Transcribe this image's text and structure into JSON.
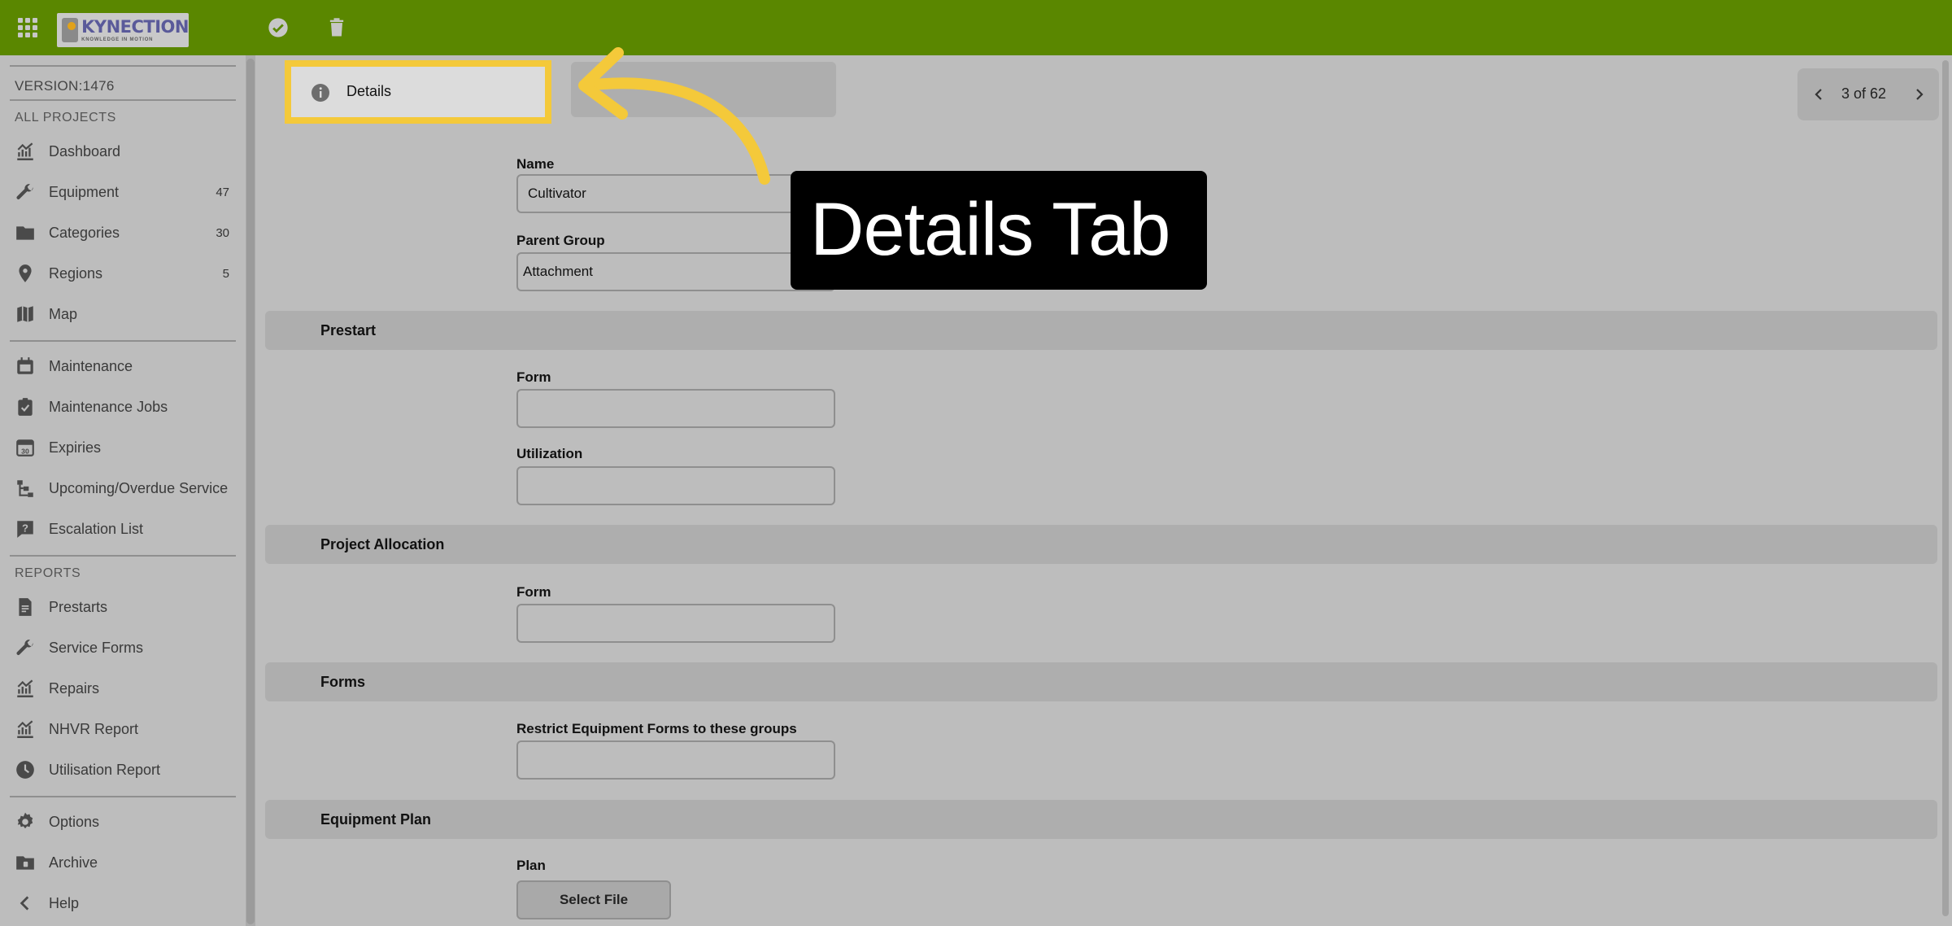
{
  "colors": {
    "topbar": "#5a8700",
    "highlight": "#f4c93a",
    "background": "#bdbdbd",
    "section": "#aeaeae",
    "callout_bg": "#000000",
    "callout_text": "#ffffff"
  },
  "topbar": {
    "logo_title": "KYNECTION",
    "logo_subtitle": "KNOWLEDGE IN MOTION",
    "icons": [
      "apps-grid-icon",
      "check-circle-icon",
      "trash-icon"
    ]
  },
  "sidebar": {
    "version": "VERSION:1476",
    "projects_heading": "ALL PROJECTS",
    "project_items": [
      {
        "label": "Dashboard",
        "count": "",
        "icon": "chart-icon"
      },
      {
        "label": "Equipment",
        "count": "47",
        "icon": "wrench-icon"
      },
      {
        "label": "Categories",
        "count": "30",
        "icon": "folder-icon"
      },
      {
        "label": "Regions",
        "count": "5",
        "icon": "map-pin-icon"
      },
      {
        "label": "Map",
        "count": "",
        "icon": "map-icon"
      }
    ],
    "maintenance_items": [
      {
        "label": "Maintenance",
        "icon": "calendar-icon"
      },
      {
        "label": "Maintenance Jobs",
        "icon": "clipboard-check-icon"
      },
      {
        "label": "Expiries",
        "icon": "calendar-30-icon"
      },
      {
        "label": "Upcoming/Overdue Service",
        "icon": "hierarchy-icon"
      },
      {
        "label": "Escalation List",
        "icon": "question-mark-icon"
      }
    ],
    "reports_heading": "REPORTS",
    "report_items": [
      {
        "label": "Prestarts",
        "icon": "document-icon"
      },
      {
        "label": "Service Forms",
        "icon": "wrench-icon"
      },
      {
        "label": "Repairs",
        "icon": "chart-icon"
      },
      {
        "label": "NHVR Report",
        "icon": "chart-icon"
      },
      {
        "label": "Utilisation Report",
        "icon": "clock-icon"
      }
    ],
    "footer_items": [
      {
        "label": "Options",
        "icon": "gear-icon"
      },
      {
        "label": "Archive",
        "icon": "archive-icon"
      },
      {
        "label": "Help",
        "icon": "chevron-left-icon"
      }
    ]
  },
  "tabs": {
    "details_label": "Details",
    "other_label": ""
  },
  "pager": {
    "text": "3 of 62"
  },
  "form": {
    "name_label": "Name",
    "name_value": "Cultivator",
    "parent_group_label": "Parent Group",
    "parent_group_value": "Attachment",
    "prestart_heading": "Prestart",
    "prestart_form_label": "Form",
    "prestart_form_value": "",
    "utilization_label": "Utilization",
    "utilization_value": "",
    "project_allocation_heading": "Project Allocation",
    "project_allocation_form_label": "Form",
    "project_allocation_form_value": "",
    "forms_heading": "Forms",
    "restrict_label": "Restrict Equipment Forms to these groups",
    "restrict_value": "",
    "equipment_plan_heading": "Equipment Plan",
    "plan_label": "Plan",
    "select_file_label": "Select File"
  },
  "callout": {
    "text": "Details Tab"
  }
}
